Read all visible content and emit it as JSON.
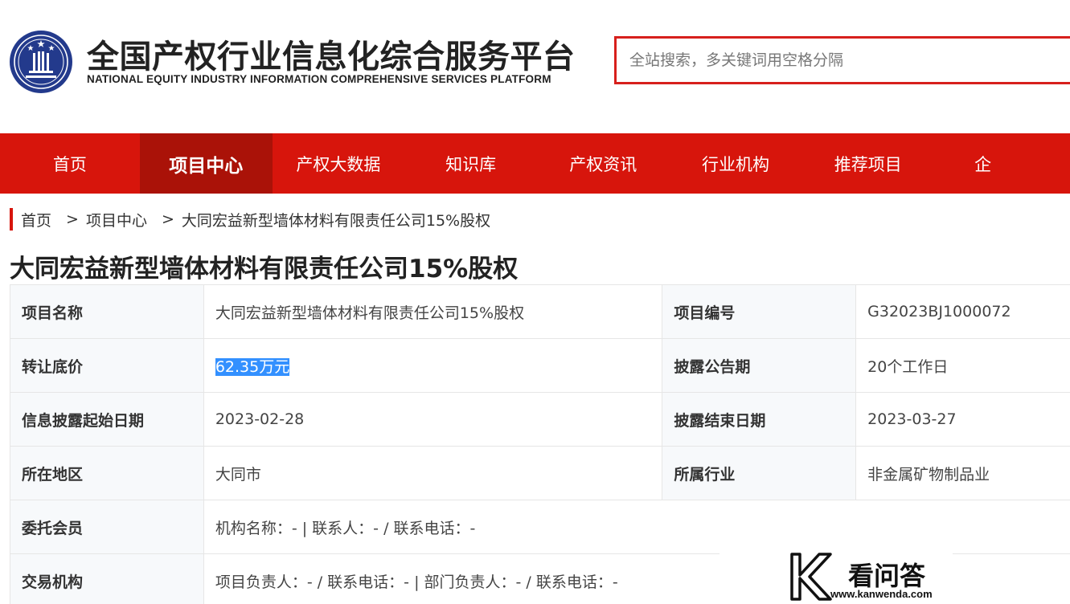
{
  "header": {
    "title": "全国产权行业信息化综合服务平台",
    "subtitle": "NATIONAL EQUITY INDUSTRY INFORMATION COMPREHENSIVE SERVICES PLATFORM",
    "search_placeholder": "全站搜索，多关键词用空格分隔",
    "brand_color": "#d7150c"
  },
  "nav": {
    "items": [
      {
        "label": "首页",
        "active": false
      },
      {
        "label": "项目中心",
        "active": true
      },
      {
        "label": "产权大数据",
        "active": false
      },
      {
        "label": "知识库",
        "active": false
      },
      {
        "label": "产权资讯",
        "active": false
      },
      {
        "label": "行业机构",
        "active": false
      },
      {
        "label": "推荐项目",
        "active": false
      },
      {
        "label": "企",
        "active": false
      }
    ]
  },
  "breadcrumb": {
    "items": [
      "首页",
      "项目中心",
      "大同宏益新型墙体材料有限责任公司15%股权"
    ],
    "separator": ">"
  },
  "page": {
    "title": "大同宏益新型墙体材料有限责任公司15%股权"
  },
  "info": {
    "project_name_label": "项目名称",
    "project_name": "大同宏益新型墙体材料有限责任公司15%股权",
    "project_code_label": "项目编号",
    "project_code": "G32023BJ1000072",
    "price_label": "转让底价",
    "price": "62.35万元",
    "disclosure_period_label": "披露公告期",
    "disclosure_period": "20个工作日",
    "start_date_label": "信息披露起始日期",
    "start_date": "2023-02-28",
    "end_date_label": "披露结束日期",
    "end_date": "2023-03-27",
    "region_label": "所在地区",
    "region": "大同市",
    "industry_label": "所属行业",
    "industry": "非金属矿物制品业",
    "member_label": "委托会员",
    "member": "机构名称：- | 联系人：- / 联系电话：-",
    "exchange_label": "交易机构",
    "exchange": "项目负责人：- / 联系电话：- | 部门负责人：- / 联系电话：-"
  },
  "watermark": {
    "name": "看问答",
    "url": "www.kanwenda.com"
  }
}
